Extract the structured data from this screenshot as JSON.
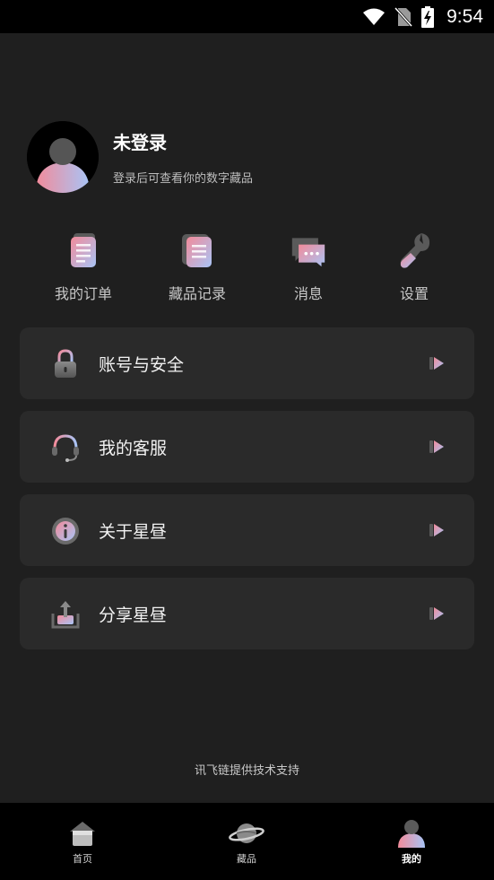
{
  "status_bar": {
    "time": "9:54"
  },
  "profile": {
    "name": "未登录",
    "subtitle": "登录后可查看你的数字藏品"
  },
  "quick_actions": [
    {
      "label": "我的订单",
      "icon": "order-icon"
    },
    {
      "label": "藏品记录",
      "icon": "collection-record-icon"
    },
    {
      "label": "消息",
      "icon": "message-icon"
    },
    {
      "label": "设置",
      "icon": "settings-wrench-icon"
    }
  ],
  "menu": [
    {
      "label": "账号与安全",
      "icon": "lock-icon"
    },
    {
      "label": "我的客服",
      "icon": "headset-icon"
    },
    {
      "label": "关于星昼",
      "icon": "info-icon"
    },
    {
      "label": "分享星昼",
      "icon": "share-upload-icon"
    }
  ],
  "footer": {
    "text": "讯飞链提供技术支持"
  },
  "tabs": [
    {
      "label": "首页",
      "icon": "home-icon",
      "active": false
    },
    {
      "label": "藏品",
      "icon": "planet-icon",
      "active": false
    },
    {
      "label": "我的",
      "icon": "profile-icon",
      "active": true
    }
  ],
  "colors": {
    "background": "#1f1f1f",
    "card": "#2a2a2a",
    "accent_pink": "#f29aa6",
    "accent_blue": "#a9c4f5"
  }
}
